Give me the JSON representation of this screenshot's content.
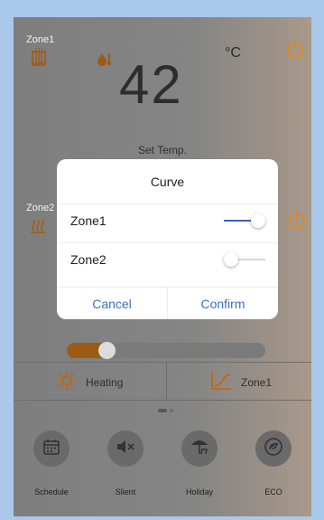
{
  "background": {
    "zone1": {
      "label": "Zone1",
      "icon": "radiator-icon"
    },
    "zone2": {
      "label": "Zone2",
      "icon": "floor-heating-icon"
    },
    "temperature": {
      "value": "42",
      "unit": "°C",
      "caption": "Set Temp."
    },
    "mode_bar": {
      "mode_label": "Heating",
      "zone_label": "Zone1"
    },
    "bottom_buttons": [
      {
        "label": "Schedule",
        "icon": "calendar-icon"
      },
      {
        "label": "Slient",
        "icon": "mute-icon"
      },
      {
        "label": "Holiday",
        "icon": "beach-umbrella-icon"
      },
      {
        "label": "ECO",
        "icon": "eco-leaf-icon"
      }
    ],
    "colors": {
      "accent_orange": "#d06a00",
      "power": "#e8860e",
      "overlay": "#808080"
    }
  },
  "dialog": {
    "title": "Curve",
    "rows": [
      {
        "label": "Zone1",
        "enabled": true
      },
      {
        "label": "Zone2",
        "enabled": false
      }
    ],
    "cancel_label": "Cancel",
    "confirm_label": "Confirm",
    "accent_color": "#3b6fc2"
  }
}
